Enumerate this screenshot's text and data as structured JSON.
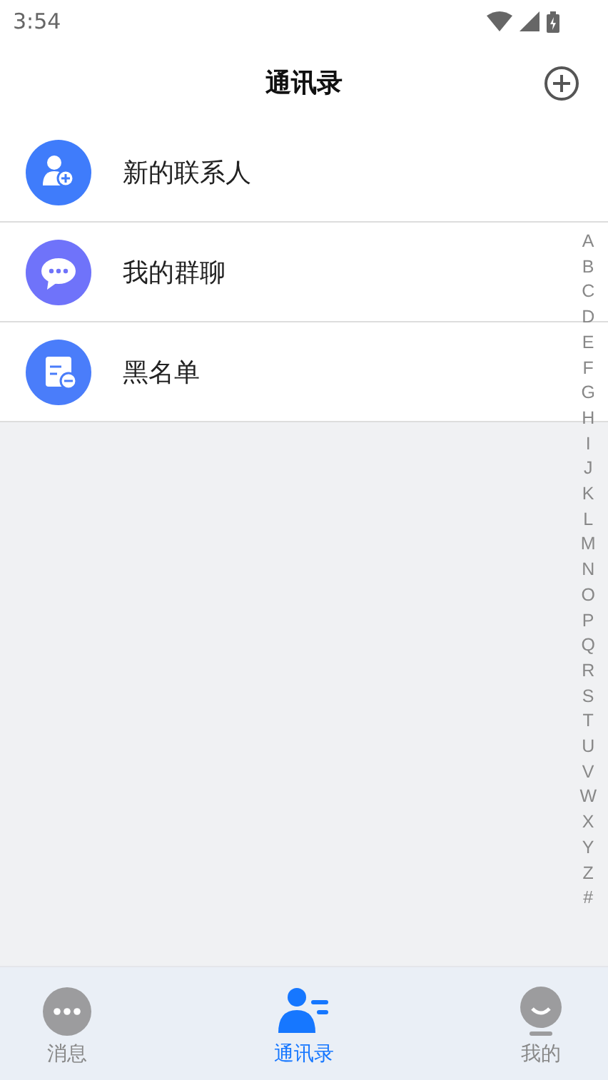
{
  "status_bar": {
    "time": "3:54"
  },
  "header": {
    "title": "通讯录"
  },
  "entries": [
    {
      "kind": "new-contact",
      "label": "新的联系人",
      "color": "#3f7cfb"
    },
    {
      "kind": "group",
      "label": "我的群聊",
      "color": "#6f73fa"
    },
    {
      "kind": "blacklist",
      "label": "黑名单",
      "color": "#4a7dfa"
    }
  ],
  "index": [
    "A",
    "B",
    "C",
    "D",
    "E",
    "F",
    "G",
    "H",
    "I",
    "J",
    "K",
    "L",
    "M",
    "N",
    "O",
    "P",
    "Q",
    "R",
    "S",
    "T",
    "U",
    "V",
    "W",
    "X",
    "Y",
    "Z",
    "#"
  ],
  "tabs": [
    {
      "kind": "messages",
      "label": "消息",
      "selected": false
    },
    {
      "kind": "contacts",
      "label": "通讯录",
      "selected": true
    },
    {
      "kind": "me",
      "label": "我的",
      "selected": false
    }
  ]
}
